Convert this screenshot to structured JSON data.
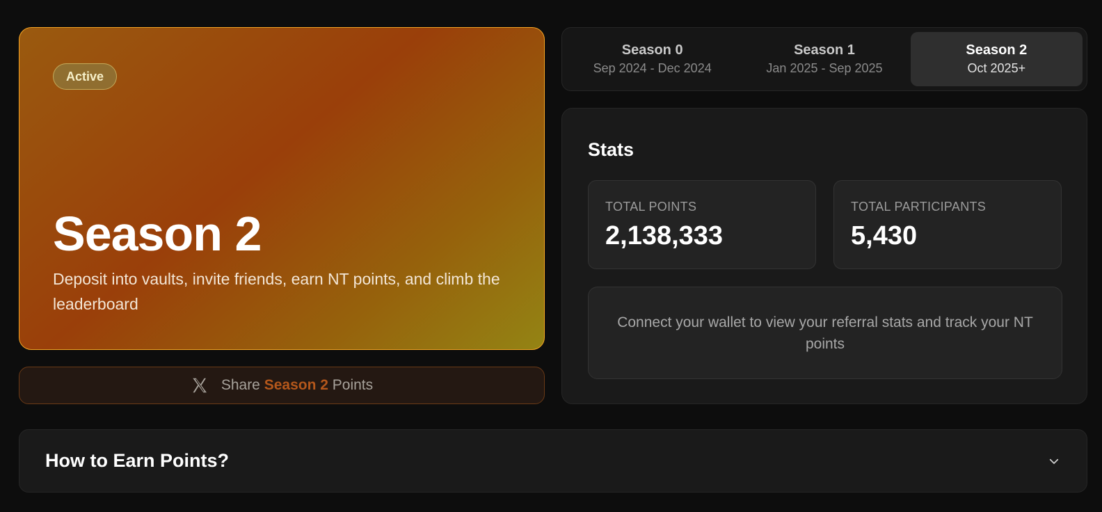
{
  "hero": {
    "badge": "Active",
    "title": "Season 2",
    "description": "Deposit into vaults, invite friends, earn NT points, and climb the leaderboard"
  },
  "share": {
    "icon": "x-logo-icon",
    "prefix": "Share",
    "highlight": "Season 2",
    "suffix": "Points",
    "highlight_color": "#b4571b"
  },
  "seasons": [
    {
      "name": "Season 0",
      "dates": "Sep 2024 - Dec 2024",
      "active": false
    },
    {
      "name": "Season 1",
      "dates": "Jan 2025 - Sep 2025",
      "active": false
    },
    {
      "name": "Season 2",
      "dates": "Oct 2025+",
      "active": true
    }
  ],
  "stats": {
    "title": "Stats",
    "total_points_label": "TOTAL POINTS",
    "total_points_value": "2,138,333",
    "total_participants_label": "TOTAL PARTICIPANTS",
    "total_participants_value": "5,430",
    "connect_message": "Connect your wallet to view your referral stats and track your NT points"
  },
  "howto": {
    "title": "How to Earn Points?",
    "icon": "chevron-down-icon"
  },
  "colors": {
    "background": "#0d0d0d",
    "hero_border": "#f5a524",
    "accent": "#b4571b"
  }
}
